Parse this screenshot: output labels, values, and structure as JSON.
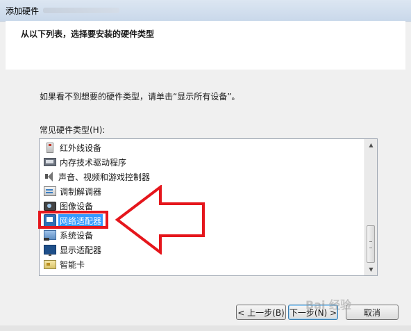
{
  "window": {
    "title": "添加硬件"
  },
  "header": {
    "instruction": "从以下列表，选择要安装的硬件类型"
  },
  "content": {
    "hint": "如果看不到想要的硬件类型，请单击“显示所有设备”。",
    "list_label": "常见硬件类型(H):"
  },
  "hardware_list": {
    "items": [
      {
        "label": "红外线设备",
        "icon": "infrared-icon"
      },
      {
        "label": "内存技术驱动程序",
        "icon": "memory-icon"
      },
      {
        "label": "声音、视频和游戏控制器",
        "icon": "speaker-icon"
      },
      {
        "label": "调制解调器",
        "icon": "modem-icon"
      },
      {
        "label": "图像设备",
        "icon": "camera-icon"
      },
      {
        "label": "网络适配器",
        "icon": "network-adapter-icon",
        "selected": true
      },
      {
        "label": "系统设备",
        "icon": "system-device-icon"
      },
      {
        "label": "显示适配器",
        "icon": "display-adapter-icon"
      },
      {
        "label": "智能卡",
        "icon": "smart-card-icon"
      }
    ]
  },
  "buttons": {
    "back": "< 上一步(B)",
    "next": "下一步(N) >",
    "cancel": "取消"
  },
  "watermark": "Bai 经验",
  "colors": {
    "selection": "#3399ff",
    "annotation_red": "#e5161c"
  }
}
